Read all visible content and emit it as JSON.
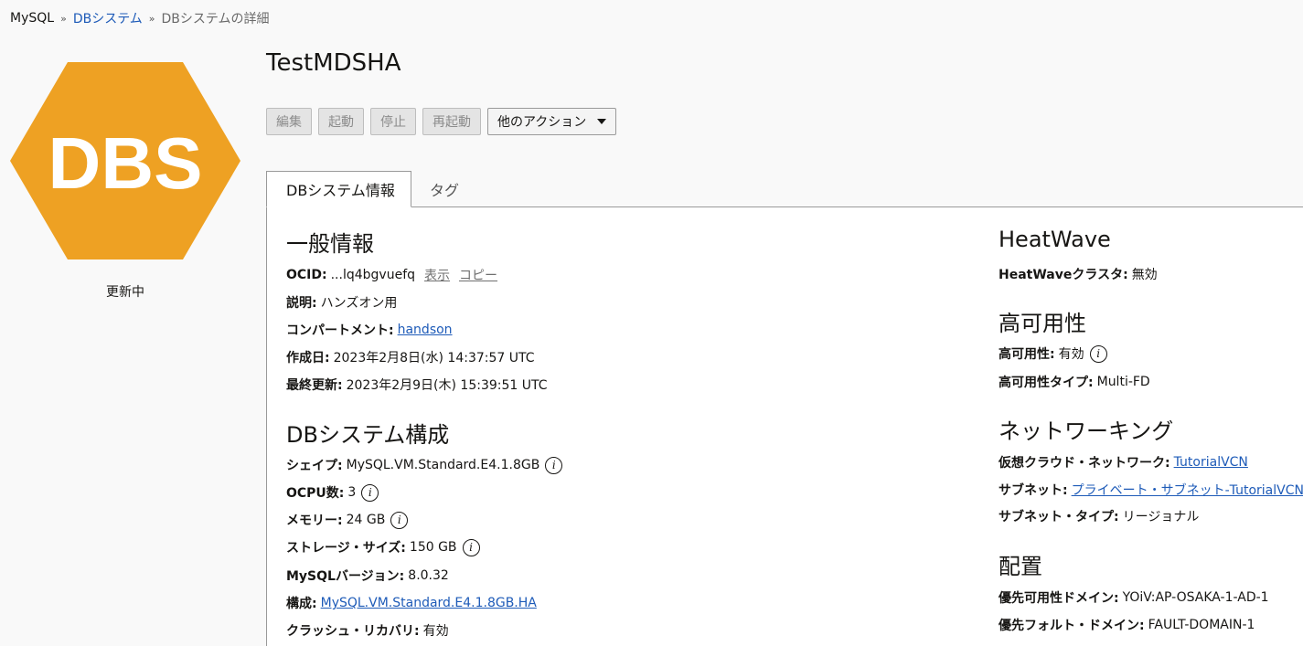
{
  "breadcrumb": {
    "root": "MySQL",
    "parent": "DBシステム",
    "current": "DBシステムの詳細"
  },
  "resource_icon": {
    "text": "DBS",
    "color": "#eea123",
    "status": "更新中"
  },
  "title": "TestMDSHA",
  "toolbar": {
    "edit": "編集",
    "start": "起動",
    "stop": "停止",
    "restart": "再起動",
    "more_actions": "他のアクション"
  },
  "tabs": {
    "info": "DBシステム情報",
    "tags": "タグ"
  },
  "general": {
    "heading": "一般情報",
    "ocid_label": "OCID:",
    "ocid_value": "...lq4bgvuefq",
    "ocid_show": "表示",
    "ocid_copy": "コピー",
    "description_label": "説明:",
    "description_value": "ハンズオン用",
    "compartment_label": "コンパートメント:",
    "compartment_value": "handson",
    "created_label": "作成日:",
    "created_value": "2023年2月8日(水) 14:37:57 UTC",
    "updated_label": "最終更新:",
    "updated_value": "2023年2月9日(木) 15:39:51 UTC"
  },
  "config": {
    "heading": "DBシステム構成",
    "shape_label": "シェイプ:",
    "shape_value": "MySQL.VM.Standard.E4.1.8GB",
    "ocpu_label": "OCPU数:",
    "ocpu_value": "3",
    "memory_label": "メモリー:",
    "memory_value": "24 GB",
    "storage_label": "ストレージ・サイズ:",
    "storage_value": "150 GB",
    "version_label": "MySQLバージョン:",
    "version_value": "8.0.32",
    "configuration_label": "構成:",
    "configuration_value": "MySQL.VM.Standard.E4.1.8GB.HA",
    "crash_recovery_label": "クラッシュ・リカバリ:",
    "crash_recovery_value": "有効"
  },
  "heatwave": {
    "heading": "HeatWave",
    "cluster_label": "HeatWaveクラスタ:",
    "cluster_value": "無効"
  },
  "ha": {
    "heading": "高可用性",
    "ha_label": "高可用性:",
    "ha_value": "有効",
    "type_label": "高可用性タイプ:",
    "type_value": "Multi-FD"
  },
  "networking": {
    "heading": "ネットワーキング",
    "vcn_label": "仮想クラウド・ネットワーク:",
    "vcn_value": "TutorialVCN",
    "subnet_label": "サブネット:",
    "subnet_value": "プライベート・サブネット-TutorialVCN",
    "subnet_type_label": "サブネット・タイプ:",
    "subnet_type_value": "リージョナル"
  },
  "placement": {
    "heading": "配置",
    "ad_label": "優先可用性ドメイン:",
    "ad_value": "YOiV:AP-OSAKA-1-AD-1",
    "fd_label": "優先フォルト・ドメイン:",
    "fd_value": "FAULT-DOMAIN-1"
  },
  "icons": {
    "info": "info-icon",
    "caret": "caret-down-icon"
  }
}
